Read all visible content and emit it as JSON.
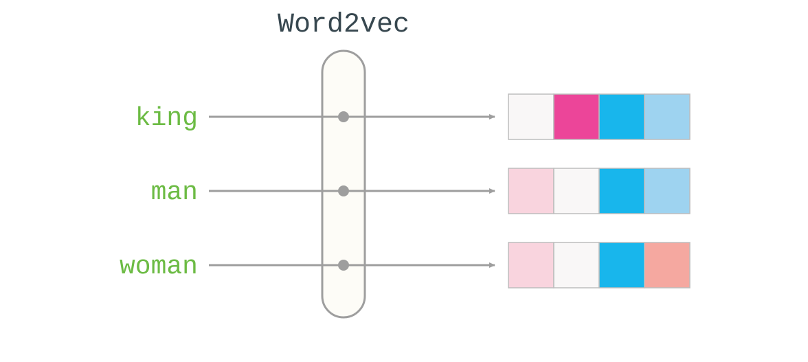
{
  "title": "Word2vec",
  "words": [
    "king",
    "man",
    "woman"
  ],
  "vectors": [
    [
      "#f9f7f7",
      "#ec4599",
      "#18b6ec",
      "#9ed3f0"
    ],
    [
      "#f9d4de",
      "#f9f7f7",
      "#18b6ec",
      "#9ed3f0"
    ],
    [
      "#f9d4de",
      "#f9f7f7",
      "#18b6ec",
      "#f5a8a0"
    ]
  ],
  "colors": {
    "word": "#6cbb44",
    "title": "#37474f",
    "stroke": "#9e9e9e",
    "capsuleFill": "#fdfcf7",
    "cellStroke": "#bdbdbd"
  }
}
